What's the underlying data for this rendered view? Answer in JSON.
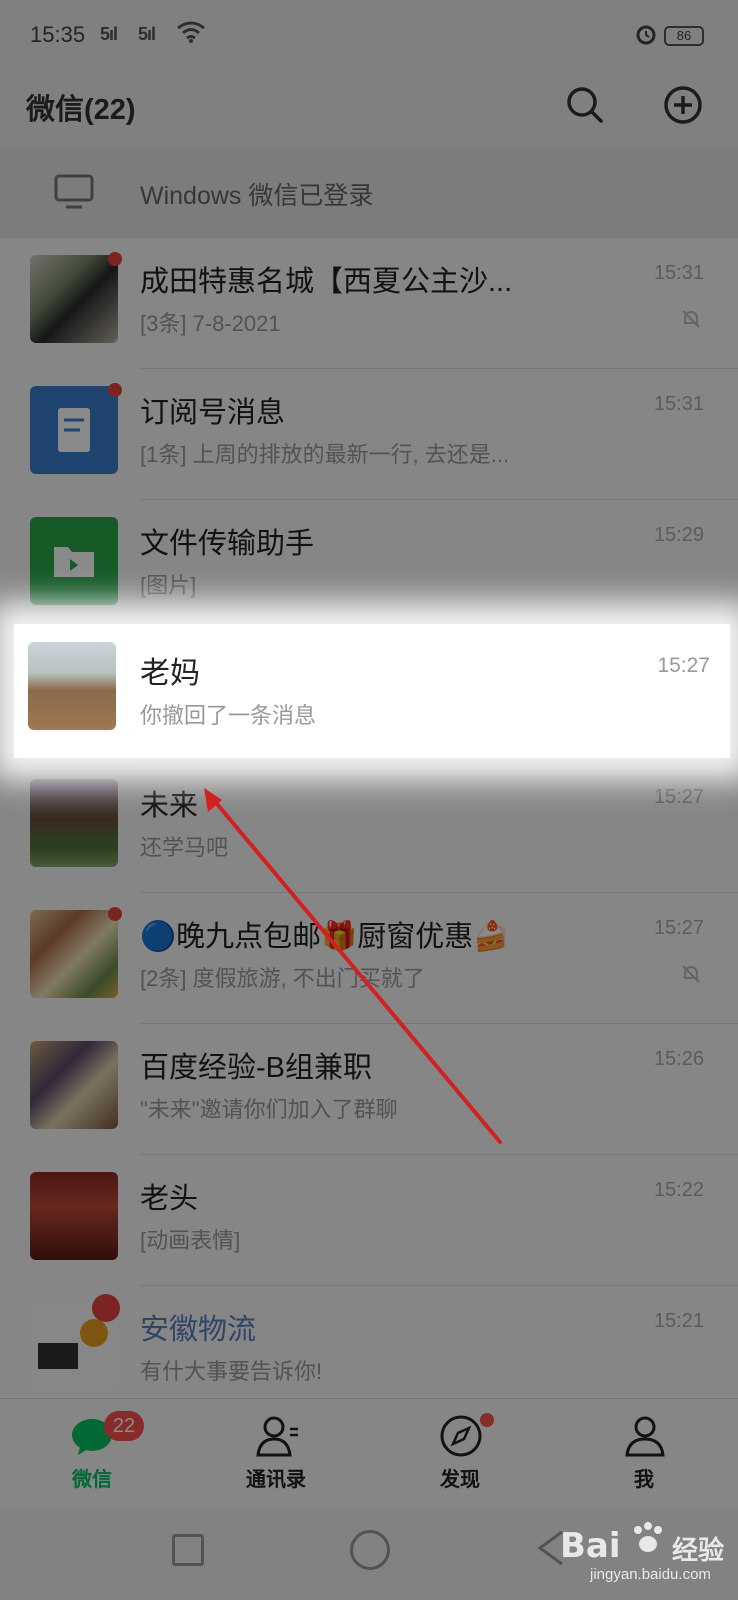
{
  "status_bar": {
    "time": "15:35",
    "signal_1": "5ıl",
    "signal_2": "5ıl",
    "battery": "86"
  },
  "header": {
    "title": "微信(22)",
    "icons": [
      "search-icon",
      "add-circle-icon"
    ]
  },
  "login_banner": {
    "text": "Windows 微信已登录",
    "icon": "monitor-icon"
  },
  "chat_list": [
    {
      "name": "成田特惠名城【西夏公主沙...",
      "preview": "[3条] 7-8-2021",
      "time": "15:31",
      "muted": true,
      "unread_dot": true
    },
    {
      "name": "订阅号消息",
      "preview": "[1条] 上周的排放的最新一行, 去还是...",
      "time": "15:31",
      "muted": false,
      "unread_dot": true
    },
    {
      "name": "文件传输助手",
      "preview": "[图片]",
      "time": "15:29",
      "muted": false,
      "unread_dot": false
    },
    {
      "name": "老妈",
      "preview": "你撤回了一条消息",
      "time": "15:27",
      "muted": false,
      "unread_dot": false,
      "highlighted": true
    },
    {
      "name": "未来",
      "preview": "还学马吧",
      "time": "15:27",
      "muted": false,
      "unread_dot": false
    },
    {
      "name": "🔵晚九点包邮🎁厨窗优惠🍰",
      "preview": "[2条] 度假旅游, 不出门买就了",
      "time": "15:27",
      "muted": true,
      "unread_dot": true
    },
    {
      "name": "百度经验-B组兼职",
      "preview": "\"未来\"邀请你们加入了群聊",
      "time": "15:26",
      "muted": false,
      "unread_dot": false
    },
    {
      "name": "老头",
      "preview": "[动画表情]",
      "time": "15:22",
      "muted": false,
      "unread_dot": false
    },
    {
      "name": "安徽物流",
      "preview": "有什大事要告诉你!",
      "time": "15:21",
      "muted": false,
      "unread_dot": true
    }
  ],
  "tabbar": {
    "tabs": [
      {
        "label": "微信",
        "icon": "chat-bubble-icon",
        "badge": "22",
        "active": true
      },
      {
        "label": "通讯录",
        "icon": "contacts-icon"
      },
      {
        "label": "发现",
        "icon": "compass-icon",
        "dot": true
      },
      {
        "label": "我",
        "icon": "person-icon"
      }
    ]
  },
  "watermark": {
    "brand": "Bai",
    "brand_suffix": "经验",
    "url": "jingyan.baidu.com"
  },
  "colors": {
    "wechat_green": "#07c160",
    "badge_red": "#fa5151",
    "annotation_arrow": "#d32020"
  }
}
